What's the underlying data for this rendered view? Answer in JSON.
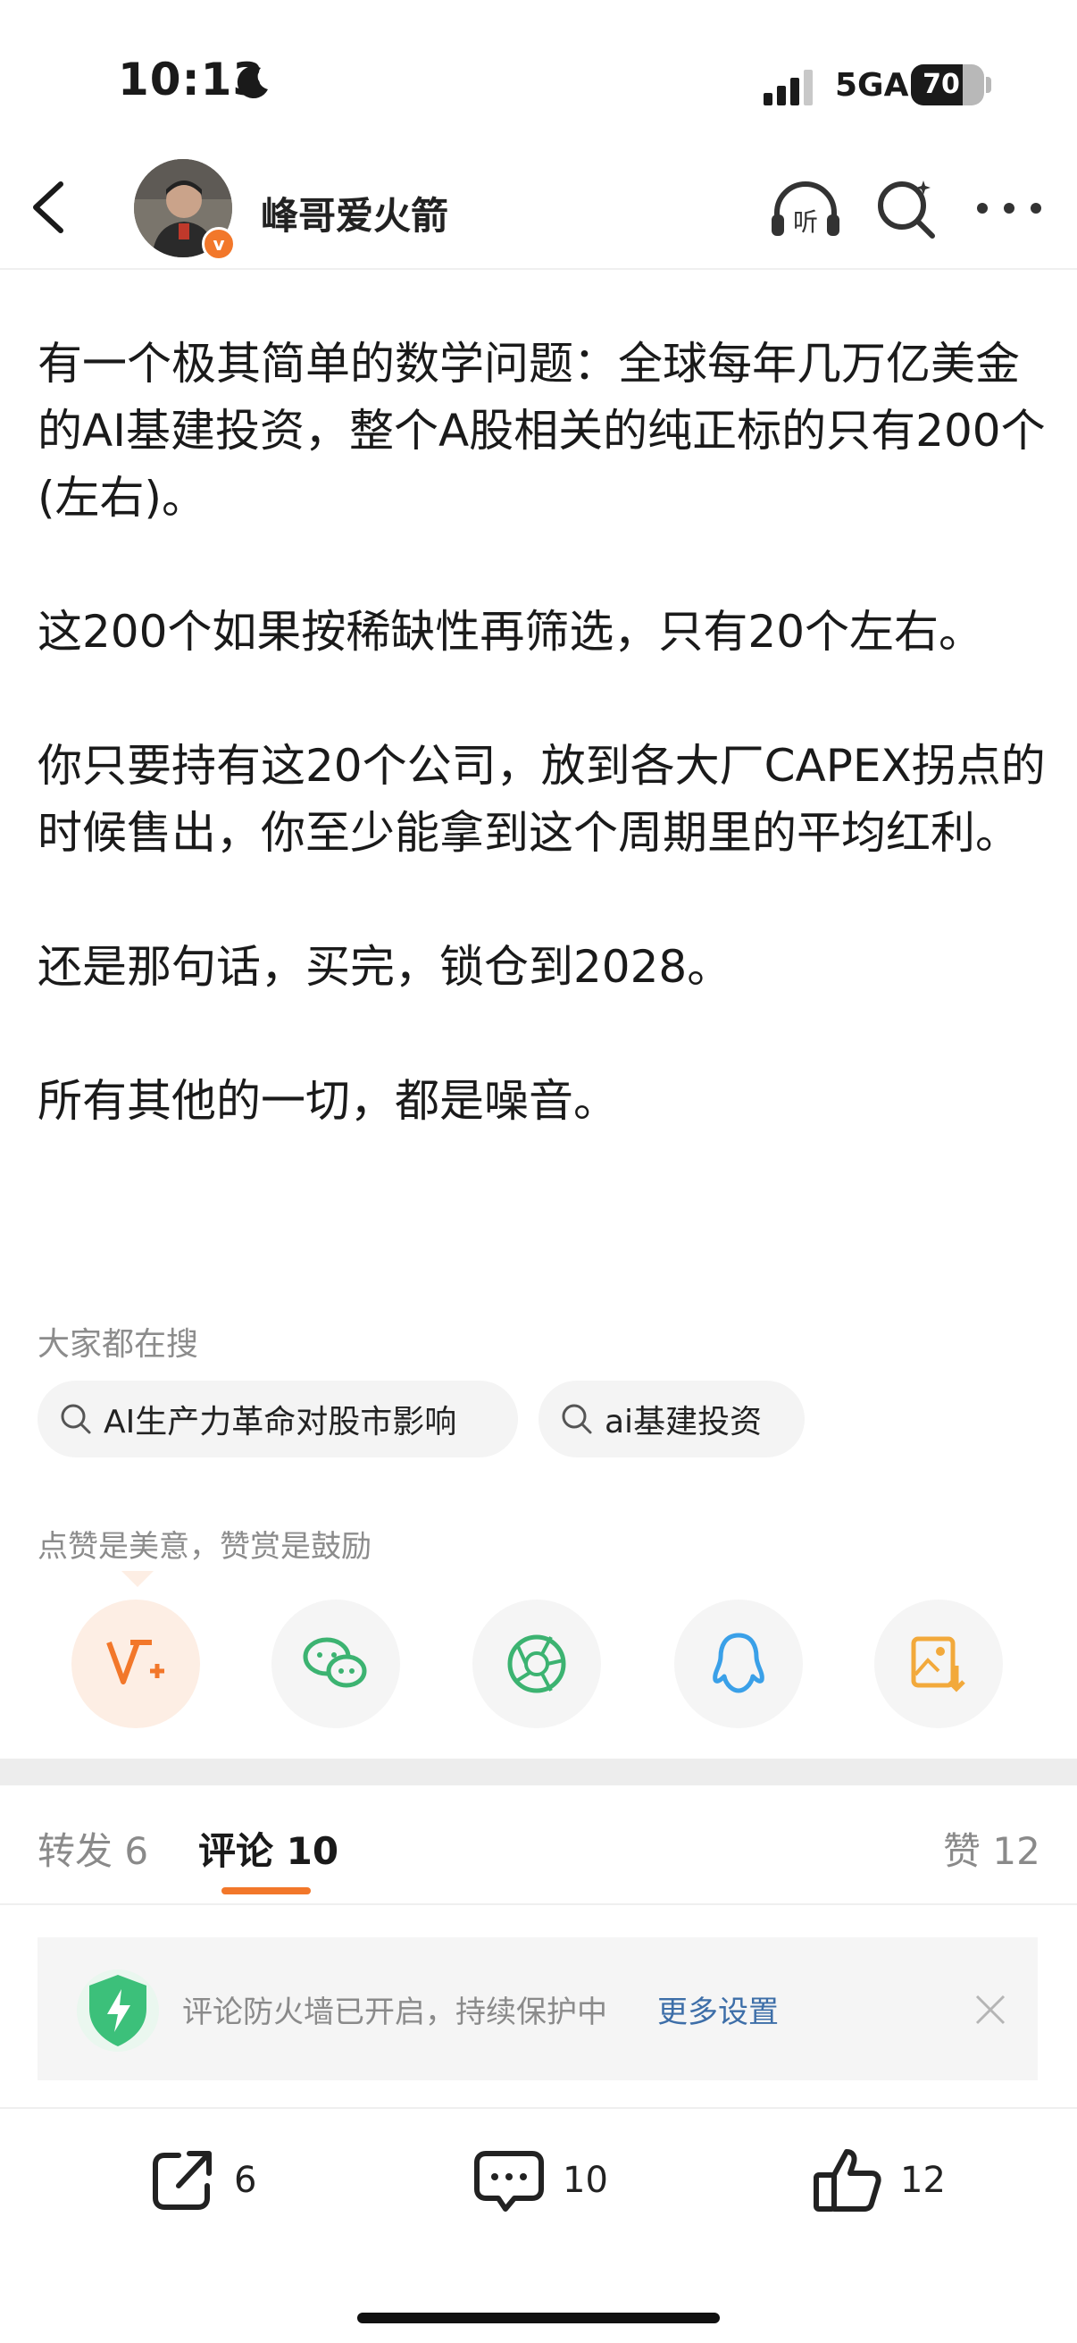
{
  "status": {
    "time": "10:13",
    "network": "5GA",
    "battery": "70"
  },
  "header": {
    "author": "峰哥爱火箭"
  },
  "post": {
    "paragraphs": [
      "有一个极其简单的数学问题：全球每年几万亿美金的AI基建投资，整个A股相关的纯正标的只有200个 (左右)。",
      "这200个如果按稀缺性再筛选，只有20个左右。",
      "你只要持有这20个公司，放到各大厂CAPEX拐点的时候售出，你至少能拿到这个周期里的平均红利。",
      "还是那句话，买完，锁仓到2028。",
      "所有其他的一切，都是噪音。"
    ]
  },
  "searches": {
    "title": "大家都在搜",
    "items": [
      "AI生产力革命对股市影响",
      "ai基建投资"
    ]
  },
  "praise": {
    "text": "点赞是美意，赞赏是鼓励"
  },
  "share": {
    "icons": [
      "reward-icon",
      "wechat-icon",
      "moments-icon",
      "qq-icon",
      "save-image-icon"
    ]
  },
  "tabs": {
    "forward": "转发 6",
    "comment": "评论 10",
    "like": "赞 12"
  },
  "notice": {
    "text": "评论防火墙已开启，持续保护中",
    "link": "更多设置"
  },
  "bottom_bar": {
    "forward_count": "6",
    "comment_count": "10",
    "like_count": "12"
  },
  "colors": {
    "accent": "#f2772a",
    "link": "#3d6ea8",
    "shield": "#3cc07a",
    "muted": "#8c8c8c"
  }
}
